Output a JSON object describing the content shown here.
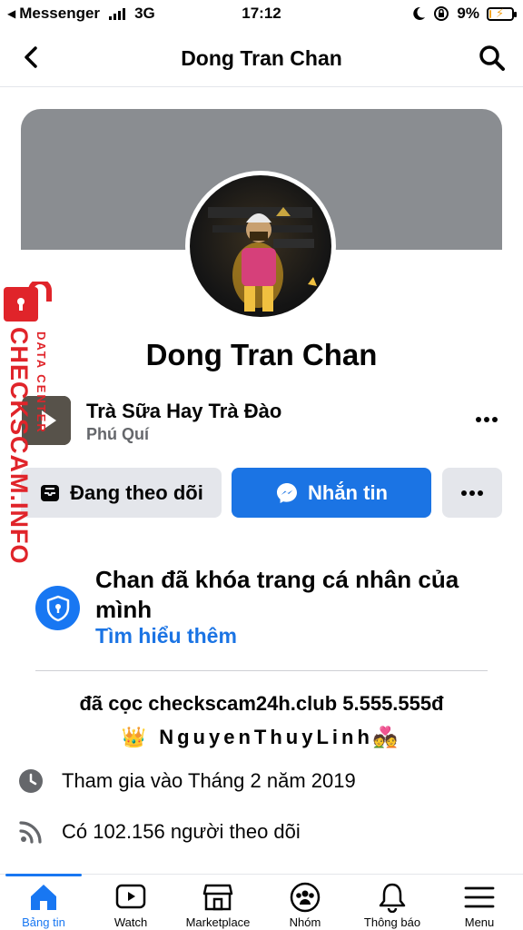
{
  "status_bar": {
    "carrier": "Messenger",
    "network": "3G",
    "time": "17:12",
    "battery": "9%",
    "battery_level": 0.09
  },
  "header": {
    "title": "Dong Tran Chan"
  },
  "profile": {
    "name": "Dong Tran Chan",
    "page_name": "Trà Sữa Hay Trà Đào",
    "page_location": "Phú Quí"
  },
  "actions": {
    "following_label": "Đang theo dõi",
    "message_label": "Nhắn tin"
  },
  "locked": {
    "title": "Chan đã khóa trang cá nhân của mình",
    "link": "Tìm hiểu thêm"
  },
  "bio": {
    "line1": "đã cọc checkscam24h.club 5.555.555đ",
    "line2_prefix": "👑",
    "line2_text": "NguyenThuyLinh",
    "line2_suffix": "💑"
  },
  "details": {
    "joined": "Tham gia vào Tháng 2 năm 2019",
    "followers": "Có 102.156 người theo dõi"
  },
  "tabs": [
    {
      "label": "Bảng tin",
      "icon": "home-icon",
      "active": true
    },
    {
      "label": "Watch",
      "icon": "watch-icon",
      "active": false
    },
    {
      "label": "Marketplace",
      "icon": "marketplace-icon",
      "active": false
    },
    {
      "label": "Nhóm",
      "icon": "groups-icon",
      "active": false
    },
    {
      "label": "Thông báo",
      "icon": "bell-icon",
      "active": false
    },
    {
      "label": "Menu",
      "icon": "menu-icon",
      "active": false
    }
  ],
  "watermark": {
    "main": "CHECKSCAM.INFO",
    "sub": "DATA CENTER"
  },
  "colors": {
    "accent": "#1877f2",
    "button_blue": "#1b74e4",
    "watermark_red": "#e0242a"
  }
}
